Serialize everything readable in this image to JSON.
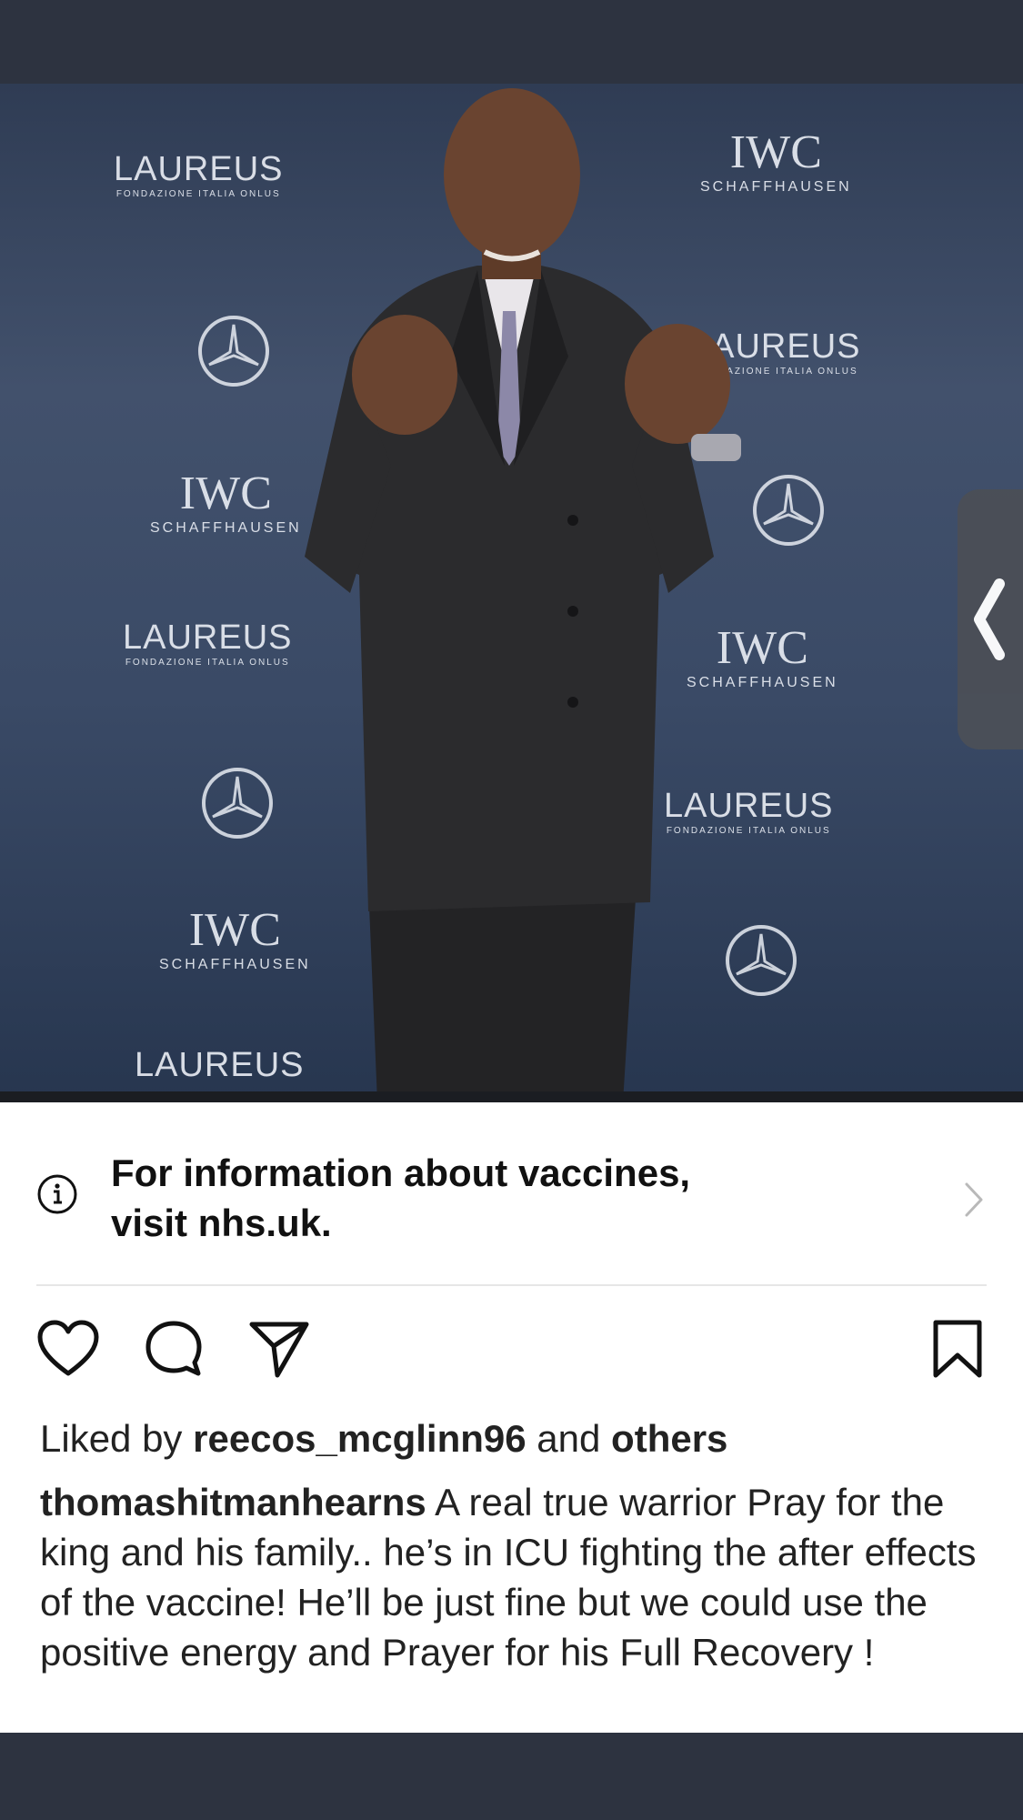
{
  "backdrop": {
    "laureus_logo": "LAUREUS",
    "laureus_sub": "FONDAZIONE ITALIA ONLUS",
    "iwc_logo": "IWC",
    "iwc_sub": "SCHAFFHAUSEN"
  },
  "vaccine_banner": {
    "line1": "For information about vaccines,",
    "line2": "visit nhs.uk.",
    "icon": "info-icon",
    "chevron": "chevron-right-icon"
  },
  "actions": {
    "like_icon": "heart-icon",
    "comment_icon": "comment-icon",
    "share_icon": "send-icon",
    "save_icon": "bookmark-icon"
  },
  "likes": {
    "prefix": "Liked by",
    "user": "reecos_mcglinn96",
    "conj": "and",
    "others": "others"
  },
  "caption": {
    "username": "thomashitmanhearns",
    "text": "A real true warrior Pray for the king and his family.. he’s in ICU fighting the after effects of the vaccine! He’ll be just fine but we could use the positive energy and Prayer for his Full Recovery !"
  },
  "colors": {
    "chrome": "#2d3340",
    "text": "#222222",
    "divider": "#e6e6e6"
  }
}
